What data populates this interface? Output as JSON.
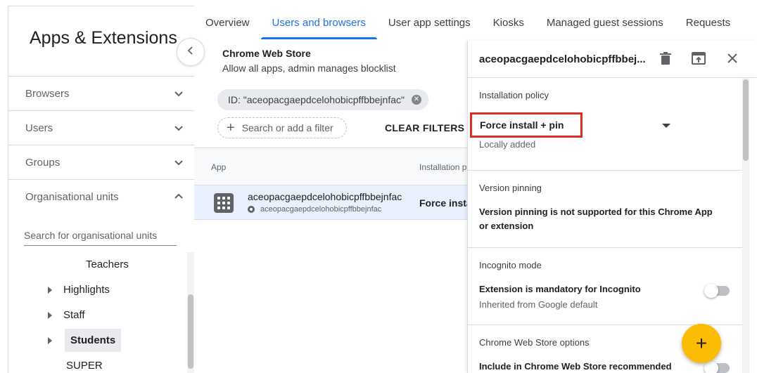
{
  "sidebar": {
    "title": "Apps & Extensions",
    "sections": [
      {
        "label": "Browsers"
      },
      {
        "label": "Users"
      },
      {
        "label": "Groups"
      },
      {
        "label": "Organisational units"
      }
    ],
    "search_placeholder": "Search for organisational units",
    "tree": {
      "root": "Teachers",
      "children": [
        "Highlights",
        "Staff",
        "Students",
        "SUPER"
      ]
    }
  },
  "tabs": [
    "Overview",
    "Users and browsers",
    "User app settings",
    "Kiosks",
    "Managed guest sessions",
    "Requests"
  ],
  "store": {
    "title": "Chrome Web Store",
    "subtitle": "Allow all apps, admin manages blocklist"
  },
  "filters": {
    "chip": "ID: \"aceopacgaepdcelohobicpffbbejnfac\"",
    "search_placeholder": "Search or add a filter",
    "clear_label": "CLEAR FILTERS"
  },
  "table": {
    "headers": [
      "App",
      "Installation p"
    ],
    "row": {
      "name": "aceopacgaepdcelohobicpffbbejnfac",
      "id": "aceopacgaepdcelohobicpffbbejnfac",
      "policy": "Force insta"
    }
  },
  "panel": {
    "title": "aceopacgaepdcelohobicpffbbej...",
    "installation": {
      "title": "Installation policy",
      "value": "Force install + pin",
      "sub": "Locally added"
    },
    "version": {
      "title": "Version pinning",
      "text": "Version pinning is not supported for this Chrome App or extension"
    },
    "incognito": {
      "title": "Incognito mode",
      "text": "Extension is mandatory for Incognito",
      "sub": "Inherited from Google default"
    },
    "cws": {
      "title": "Chrome Web Store options",
      "text": "Include in Chrome Web Store recommended"
    }
  },
  "fab": {
    "label": "+"
  },
  "colors": {
    "accent": "#1a73e8",
    "highlight_border": "#d93025",
    "fab": "#fbbc04",
    "row_selected": "#e8f0fe"
  }
}
